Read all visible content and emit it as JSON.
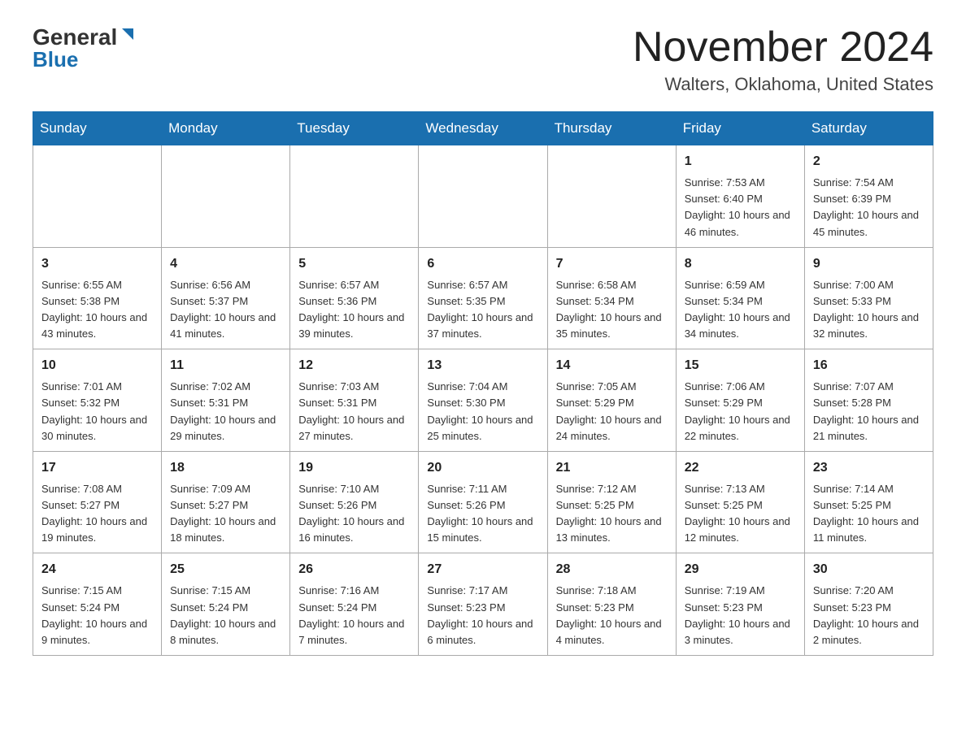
{
  "header": {
    "logo_general": "General",
    "logo_blue": "Blue",
    "title": "November 2024",
    "location": "Walters, Oklahoma, United States"
  },
  "days_of_week": [
    "Sunday",
    "Monday",
    "Tuesday",
    "Wednesday",
    "Thursday",
    "Friday",
    "Saturday"
  ],
  "weeks": [
    [
      {
        "day": "",
        "info": ""
      },
      {
        "day": "",
        "info": ""
      },
      {
        "day": "",
        "info": ""
      },
      {
        "day": "",
        "info": ""
      },
      {
        "day": "",
        "info": ""
      },
      {
        "day": "1",
        "info": "Sunrise: 7:53 AM\nSunset: 6:40 PM\nDaylight: 10 hours and 46 minutes."
      },
      {
        "day": "2",
        "info": "Sunrise: 7:54 AM\nSunset: 6:39 PM\nDaylight: 10 hours and 45 minutes."
      }
    ],
    [
      {
        "day": "3",
        "info": "Sunrise: 6:55 AM\nSunset: 5:38 PM\nDaylight: 10 hours and 43 minutes."
      },
      {
        "day": "4",
        "info": "Sunrise: 6:56 AM\nSunset: 5:37 PM\nDaylight: 10 hours and 41 minutes."
      },
      {
        "day": "5",
        "info": "Sunrise: 6:57 AM\nSunset: 5:36 PM\nDaylight: 10 hours and 39 minutes."
      },
      {
        "day": "6",
        "info": "Sunrise: 6:57 AM\nSunset: 5:35 PM\nDaylight: 10 hours and 37 minutes."
      },
      {
        "day": "7",
        "info": "Sunrise: 6:58 AM\nSunset: 5:34 PM\nDaylight: 10 hours and 35 minutes."
      },
      {
        "day": "8",
        "info": "Sunrise: 6:59 AM\nSunset: 5:34 PM\nDaylight: 10 hours and 34 minutes."
      },
      {
        "day": "9",
        "info": "Sunrise: 7:00 AM\nSunset: 5:33 PM\nDaylight: 10 hours and 32 minutes."
      }
    ],
    [
      {
        "day": "10",
        "info": "Sunrise: 7:01 AM\nSunset: 5:32 PM\nDaylight: 10 hours and 30 minutes."
      },
      {
        "day": "11",
        "info": "Sunrise: 7:02 AM\nSunset: 5:31 PM\nDaylight: 10 hours and 29 minutes."
      },
      {
        "day": "12",
        "info": "Sunrise: 7:03 AM\nSunset: 5:31 PM\nDaylight: 10 hours and 27 minutes."
      },
      {
        "day": "13",
        "info": "Sunrise: 7:04 AM\nSunset: 5:30 PM\nDaylight: 10 hours and 25 minutes."
      },
      {
        "day": "14",
        "info": "Sunrise: 7:05 AM\nSunset: 5:29 PM\nDaylight: 10 hours and 24 minutes."
      },
      {
        "day": "15",
        "info": "Sunrise: 7:06 AM\nSunset: 5:29 PM\nDaylight: 10 hours and 22 minutes."
      },
      {
        "day": "16",
        "info": "Sunrise: 7:07 AM\nSunset: 5:28 PM\nDaylight: 10 hours and 21 minutes."
      }
    ],
    [
      {
        "day": "17",
        "info": "Sunrise: 7:08 AM\nSunset: 5:27 PM\nDaylight: 10 hours and 19 minutes."
      },
      {
        "day": "18",
        "info": "Sunrise: 7:09 AM\nSunset: 5:27 PM\nDaylight: 10 hours and 18 minutes."
      },
      {
        "day": "19",
        "info": "Sunrise: 7:10 AM\nSunset: 5:26 PM\nDaylight: 10 hours and 16 minutes."
      },
      {
        "day": "20",
        "info": "Sunrise: 7:11 AM\nSunset: 5:26 PM\nDaylight: 10 hours and 15 minutes."
      },
      {
        "day": "21",
        "info": "Sunrise: 7:12 AM\nSunset: 5:25 PM\nDaylight: 10 hours and 13 minutes."
      },
      {
        "day": "22",
        "info": "Sunrise: 7:13 AM\nSunset: 5:25 PM\nDaylight: 10 hours and 12 minutes."
      },
      {
        "day": "23",
        "info": "Sunrise: 7:14 AM\nSunset: 5:25 PM\nDaylight: 10 hours and 11 minutes."
      }
    ],
    [
      {
        "day": "24",
        "info": "Sunrise: 7:15 AM\nSunset: 5:24 PM\nDaylight: 10 hours and 9 minutes."
      },
      {
        "day": "25",
        "info": "Sunrise: 7:15 AM\nSunset: 5:24 PM\nDaylight: 10 hours and 8 minutes."
      },
      {
        "day": "26",
        "info": "Sunrise: 7:16 AM\nSunset: 5:24 PM\nDaylight: 10 hours and 7 minutes."
      },
      {
        "day": "27",
        "info": "Sunrise: 7:17 AM\nSunset: 5:23 PM\nDaylight: 10 hours and 6 minutes."
      },
      {
        "day": "28",
        "info": "Sunrise: 7:18 AM\nSunset: 5:23 PM\nDaylight: 10 hours and 4 minutes."
      },
      {
        "day": "29",
        "info": "Sunrise: 7:19 AM\nSunset: 5:23 PM\nDaylight: 10 hours and 3 minutes."
      },
      {
        "day": "30",
        "info": "Sunrise: 7:20 AM\nSunset: 5:23 PM\nDaylight: 10 hours and 2 minutes."
      }
    ]
  ]
}
